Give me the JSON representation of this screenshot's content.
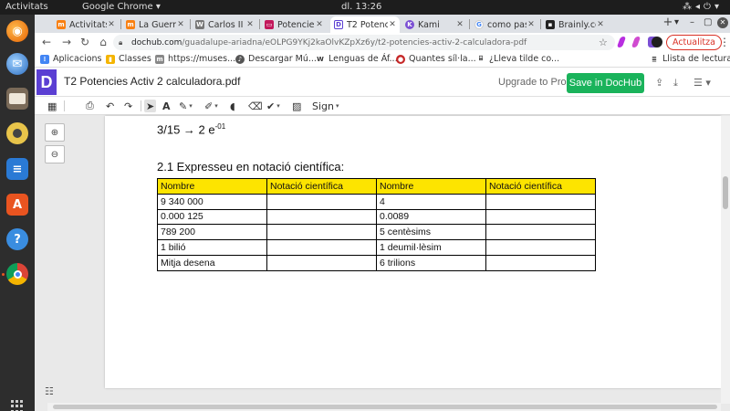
{
  "os_bar": {
    "activities": "Activitats",
    "app_name": "Google Chrome ▾",
    "clock": "dl. 13:26"
  },
  "tabs": [
    {
      "label": "Activitats",
      "favicon": "moodle-icon",
      "color": "#f98012"
    },
    {
      "label": "La Guerra",
      "favicon": "moodle-icon",
      "color": "#f98012"
    },
    {
      "label": "Carlos II d",
      "favicon": "wikipedia-icon",
      "color": "#777777"
    },
    {
      "label": "Potencies",
      "favicon": "presentation-icon",
      "color": "#c2185b"
    },
    {
      "label": "T2 Potenc",
      "favicon": "dochub-icon",
      "color": "#5b3fd3",
      "active": true
    },
    {
      "label": "Kami",
      "favicon": "kami-icon",
      "color": "#7b4fd4"
    },
    {
      "label": "como pas",
      "favicon": "google-icon",
      "color": "#4285f4"
    },
    {
      "label": "Brainly.co",
      "favicon": "brainly-icon",
      "color": "#222222"
    }
  ],
  "address_bar": {
    "host": "dochub.com",
    "path": "/guadalupe-ariadna/eOLPG9YKj2kaOlvKZpXz6y/t2-potencies-activ-2-calculadora-pdf"
  },
  "update_button": "Actualitza",
  "bookmarks": [
    {
      "label": "Aplicacions",
      "icon": "apps-grid-icon"
    },
    {
      "label": "Classes",
      "icon": "classroom-icon"
    },
    {
      "label": "https://muses....",
      "icon": "museum-icon"
    },
    {
      "label": "Descargar Mú...",
      "icon": "music-icon"
    },
    {
      "label": "Lenguas de Áf...",
      "icon": "wikipedia-icon"
    },
    {
      "label": "Quantes síl·la...",
      "icon": "website-icon"
    },
    {
      "label": "¿Lleva tilde co...",
      "icon": "book-icon"
    }
  ],
  "reading_list": "Llista de lectura",
  "dochub": {
    "logo_letter": "D",
    "document_title": "T2 Potencies Activ 2 calculadora.pdf",
    "upgrade_label": "Upgrade to Pro",
    "save_label": "Save in DocHub",
    "sign_label": "Sign"
  },
  "document": {
    "fraction_line": {
      "base": "3/15 → 2 e",
      "exponent": "-01"
    },
    "section_title": "2.1 Expresseu en notació científica:",
    "table": {
      "headers": [
        "Nombre",
        "Notació científica",
        "Nombre",
        "Notació científica"
      ],
      "rows": [
        [
          "9 340 000",
          "",
          "4",
          ""
        ],
        [
          "0.000 125",
          "",
          "0.0089",
          ""
        ],
        [
          "789 200",
          "",
          "5 centèsims",
          ""
        ],
        [
          "1 bilió",
          "",
          "1 deumil·lèsim",
          ""
        ],
        [
          "Mitja desena",
          "",
          "6 trilions",
          ""
        ]
      ],
      "header_color": "#fde400"
    }
  },
  "colors": {
    "dochub_purple": "#5b3fd3",
    "save_green": "#1ab35b",
    "update_red": "#d93025"
  }
}
